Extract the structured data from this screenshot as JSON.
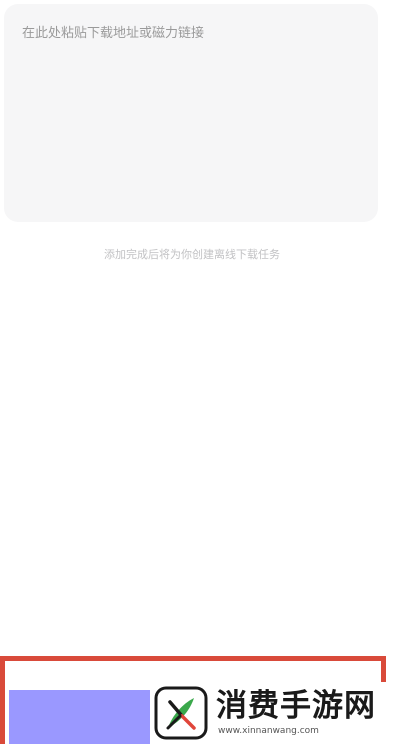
{
  "url_input": {
    "placeholder": "在此处粘贴下载地址或磁力链接",
    "value": ""
  },
  "hint_text": "添加完成后将为你创建离线下载任务",
  "confirm_button": {
    "color": "#9a98ff"
  },
  "highlight_color": "#d94a3a",
  "watermark": {
    "title": "消费手游网",
    "url": "www.xinnanwang.com",
    "logo_icon": "leaf-logo-icon"
  }
}
